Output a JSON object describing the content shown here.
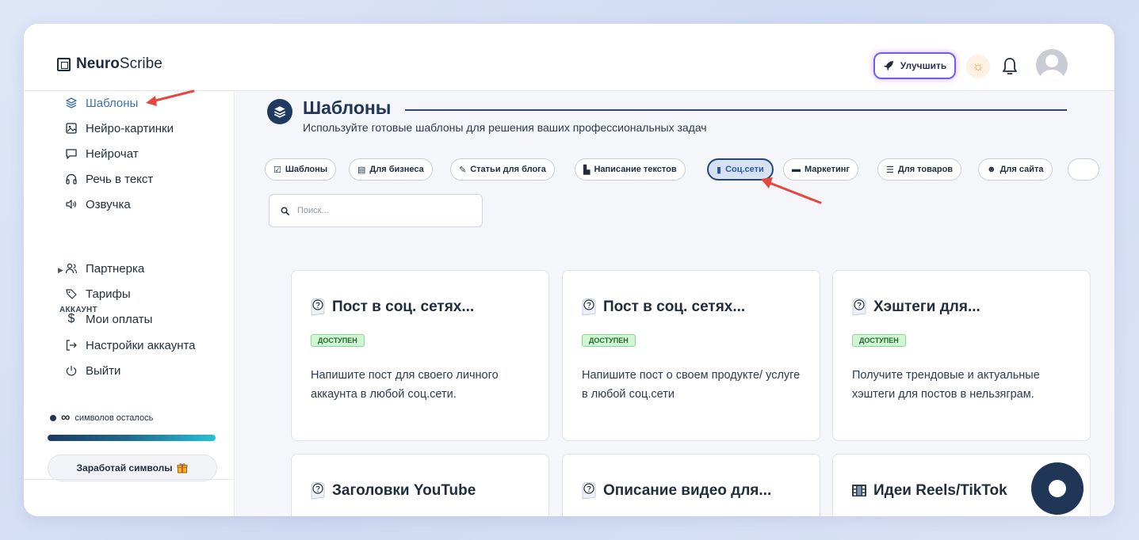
{
  "brand": {
    "bold": "Neuro",
    "light": "Scribe"
  },
  "header": {
    "upgrade_label": "Улучшить"
  },
  "sidebar": {
    "items": [
      {
        "label": "Шаблоны",
        "icon": "layers-icon"
      },
      {
        "label": "Нейро-картинки",
        "icon": "image-icon"
      },
      {
        "label": "Нейрочат",
        "icon": "chat-icon"
      },
      {
        "label": "Речь в текст",
        "icon": "headphones-icon"
      },
      {
        "label": "Озвучка",
        "icon": "speaker-icon"
      }
    ],
    "account_section_label": "АККАУНТ",
    "account_items": [
      {
        "label": "Партнерка",
        "icon": "users-icon"
      },
      {
        "label": "Тарифы",
        "icon": "tag-icon"
      },
      {
        "label": "Мои оплаты",
        "icon": "dollar-icon"
      },
      {
        "label": "Настройки аккаунта",
        "icon": "logout-arrow-icon"
      },
      {
        "label": "Выйти",
        "icon": "power-icon"
      }
    ],
    "chars_symbol": "∞",
    "chars_label": "символов осталось",
    "chars_progress": 1.0,
    "earn_label": "Заработай символы"
  },
  "main": {
    "title": "Шаблоны",
    "subtitle": "Используйте готовые шаблоны для решения ваших профессиональных задач",
    "search_placeholder": "Поиск...",
    "chips": [
      {
        "label": "Шаблоны",
        "icon": "☑"
      },
      {
        "label": "Для бизнеса",
        "icon": "▤"
      },
      {
        "label": "Статьи для блога",
        "icon": "✎"
      },
      {
        "label": "Написание текстов",
        "icon": "▙"
      },
      {
        "label": "Соц.сети",
        "icon": "▮",
        "selected": true
      },
      {
        "label": "Маркетинг",
        "icon": "▬"
      },
      {
        "label": "Для товаров",
        "icon": "☰"
      },
      {
        "label": "Для сайта",
        "icon": "☻"
      }
    ],
    "cards": [
      {
        "title": "Пост в соц. сетях...",
        "badge": "ДОСТУПЕН",
        "desc": "Напишите пост для своего личного аккаунта в любой соц.сети."
      },
      {
        "title": "Пост в соц. сетях...",
        "badge": "ДОСТУПЕН",
        "desc": "Напишите пост о своем продукте/ услуге в любой соц.сети"
      },
      {
        "title": "Хэштеги для...",
        "badge": "ДОСТУПЕН",
        "desc": "Получите трендовые и актуальные хэштеги для постов в нельзяграм."
      },
      {
        "title": "Заголовки YouTube",
        "badge": "",
        "desc": ""
      },
      {
        "title": "Описание видео для...",
        "badge": "",
        "desc": ""
      },
      {
        "title": "Идеи Reels/TikTok",
        "badge": "",
        "desc": ""
      }
    ]
  },
  "colors": {
    "accent": "#1f3656",
    "active_link": "#3e6fb3",
    "badge_bg": "#d2f5d6",
    "annotation_arrow": "#e8453c"
  }
}
